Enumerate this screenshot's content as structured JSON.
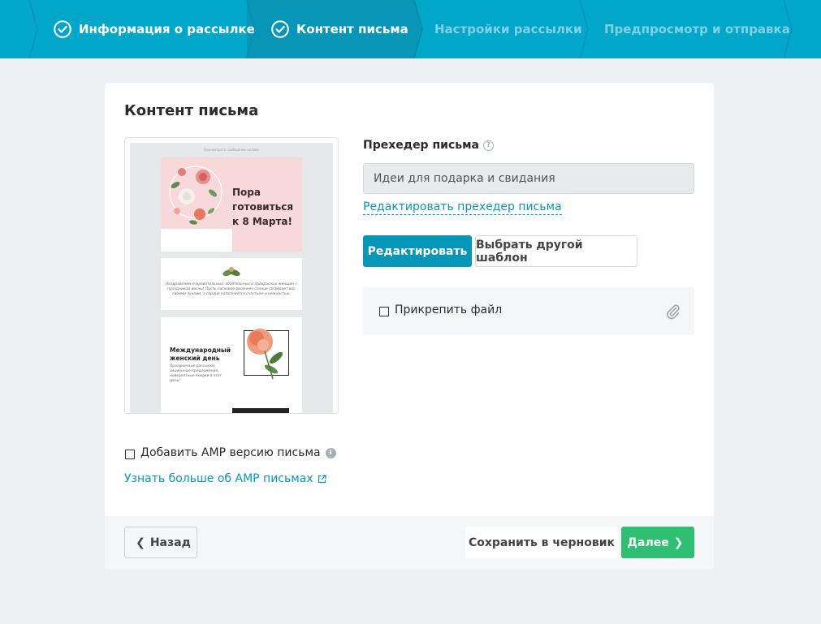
{
  "stepper": {
    "steps": [
      {
        "label": "Информация о рассылке",
        "state": "done"
      },
      {
        "label": "Контент письма",
        "state": "active"
      },
      {
        "label": "Настройки рассылки",
        "state": "pending"
      },
      {
        "label": "Предпросмотр и отправка",
        "state": "pending"
      }
    ]
  },
  "content": {
    "title": "Контент письма",
    "preview": {
      "top_link": "Просмотреть сообщение онлайн",
      "hero_title": "Пора готовиться к 8 Марта!",
      "greeting": "Поздравляем очаровательных, обаятельных и прекрасных женщин с праздником весны! Пусть ласковое весеннее солнце согревает вас своими лучами, а сердце наполняется счастьем и нежностью.",
      "block_title": "Международный женский день",
      "block_text": "Праздничные рассылки, акционные предложения, невероятные скидки в этот день!"
    },
    "preheader": {
      "label": "Прехедер письма",
      "value": "Идеи для подарка и свидания",
      "edit_link": "Редактировать прехедер письма"
    },
    "buttons": {
      "edit": "Редактировать",
      "choose_template": "Выбрать другой шаблон"
    },
    "attach": {
      "label": "Прикрепить файл",
      "checked": false
    },
    "amp": {
      "label": "Добавить AMP версию письма",
      "checked": false,
      "learn_more": "Узнать больше об AMP письмах"
    }
  },
  "footer": {
    "back": "Назад",
    "save_draft": "Сохранить в черновик",
    "next": "Далее"
  },
  "colors": {
    "stepper_bg": "#02a6c9",
    "stepper_active": "#0796b8",
    "primary": "#0796b8",
    "success": "#2ebf73"
  }
}
